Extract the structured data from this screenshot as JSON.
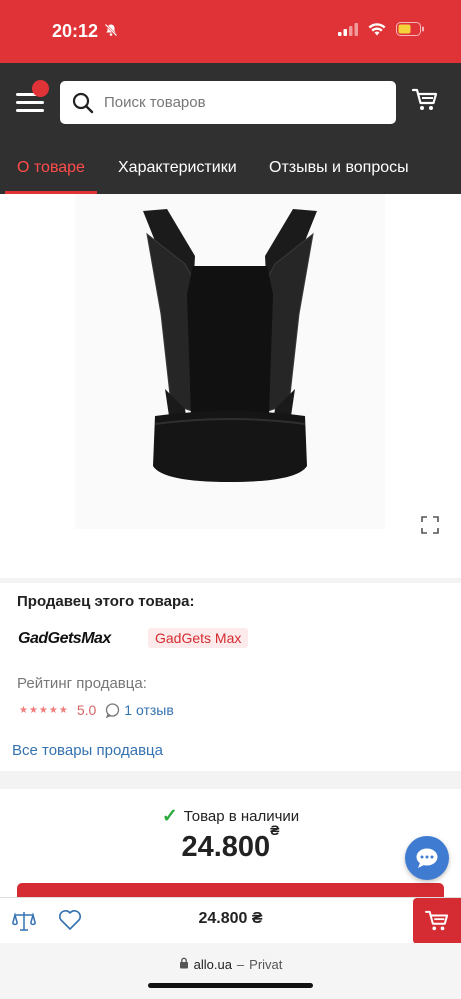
{
  "status": {
    "time": "20:12",
    "icons": [
      "bell-muted-icon",
      "signal-icon",
      "wifi-icon",
      "battery-icon"
    ],
    "battery_color": "#f6d23a"
  },
  "header": {
    "search_placeholder": "Поиск товаров",
    "tabs": [
      {
        "label": "О товаре",
        "active": true
      },
      {
        "label": "Характеристики",
        "active": false
      },
      {
        "label": "Отзывы и вопросы",
        "active": false
      }
    ]
  },
  "seller": {
    "title": "Продавец этого товара:",
    "logo_text": "GadGetsMax",
    "name": "GadGets Max",
    "rating_label": "Рейтинг продавца:",
    "rating_value": "5.0",
    "stars": "★★★★★",
    "reviews": "1 отзыв",
    "all_goods_link": "Все товары продавца"
  },
  "product": {
    "stock_status": "Товар в наличии",
    "price": "24.800",
    "currency": "₴"
  },
  "bottom_bar": {
    "price": "24.800 ₴"
  },
  "browser": {
    "domain": "allo.ua",
    "separator": "–",
    "label": "Privat"
  },
  "colors": {
    "brand_red": "#e03338",
    "header_dark": "#303030",
    "link_blue": "#3572b0",
    "success_green": "#2eab40",
    "chat_blue": "#3f7bd0"
  }
}
